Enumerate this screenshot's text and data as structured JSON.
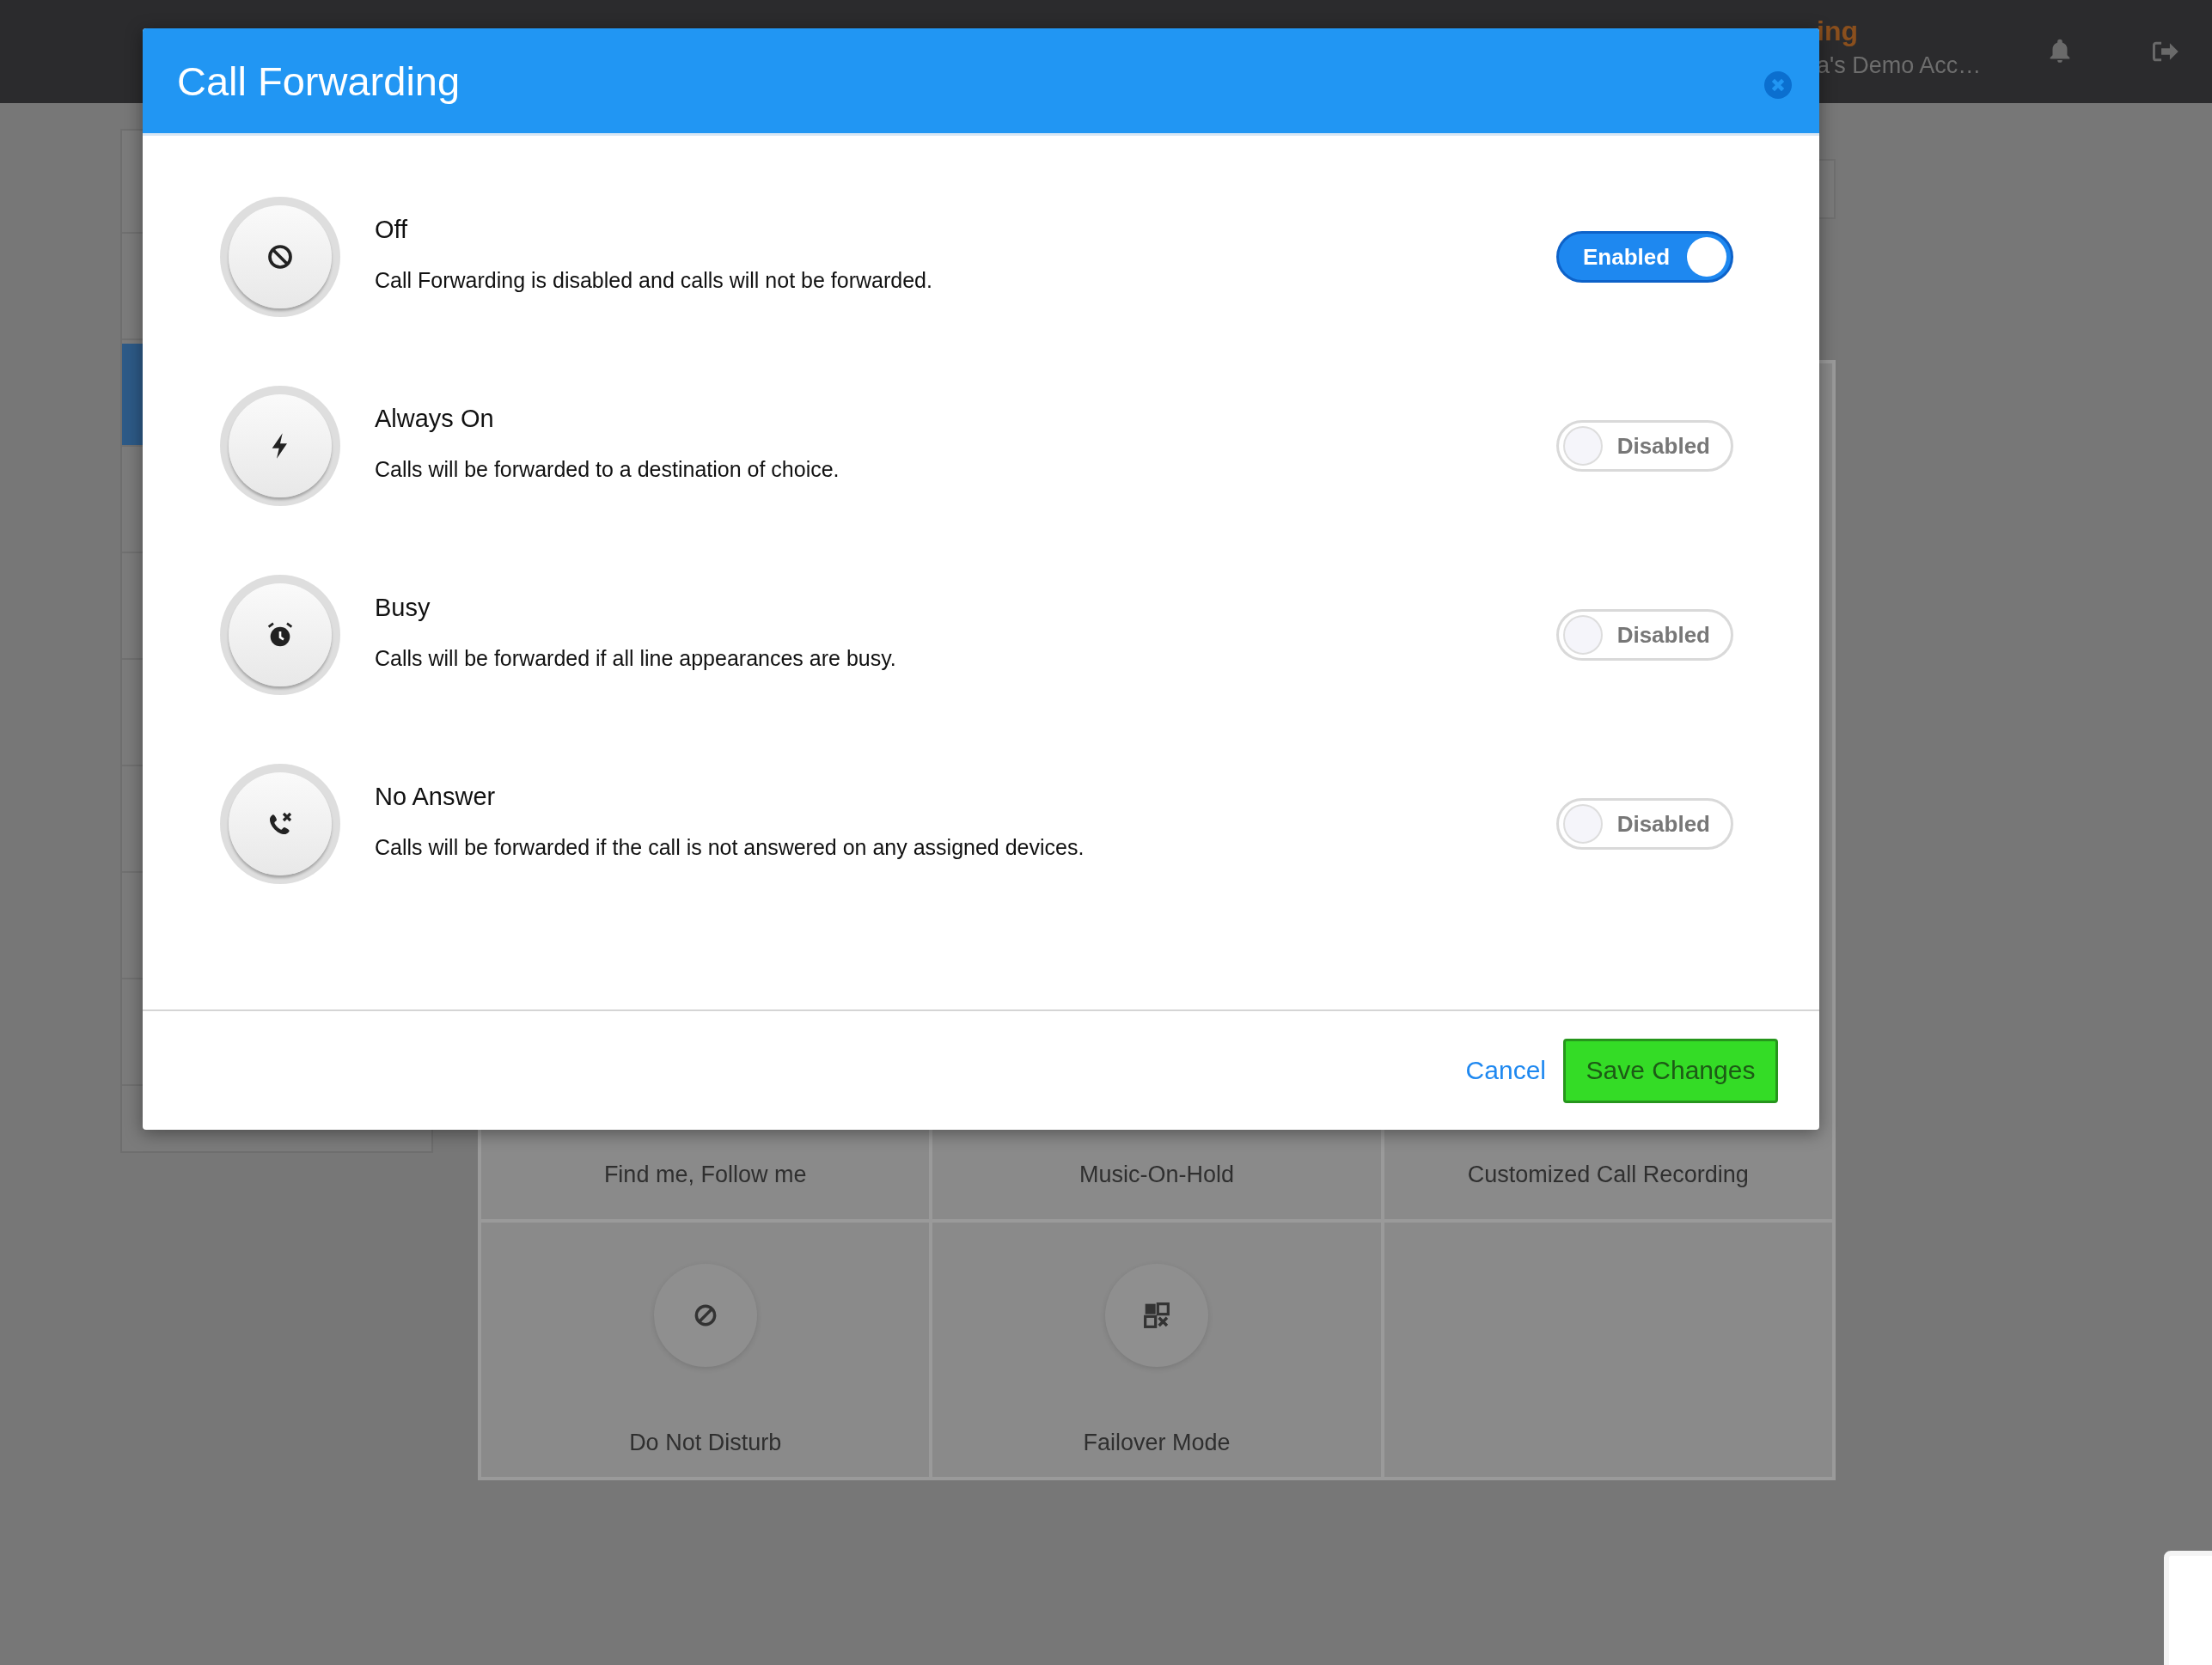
{
  "top_bar": {
    "masquerade_label": "ing",
    "account_name": "a's Demo Acc…"
  },
  "dialog": {
    "title": "Call Forwarding",
    "options": [
      {
        "kind": "ban",
        "title": "Off",
        "description": "Call Forwarding is disabled and calls will not be forwarded.",
        "on": true,
        "toggle_label": "Enabled"
      },
      {
        "kind": "bolt",
        "title": "Always On",
        "description": "Calls will be forwarded to a destination of choice.",
        "on": false,
        "toggle_label": "Disabled"
      },
      {
        "kind": "alarm",
        "title": "Busy",
        "description": "Calls will be forwarded if all line appearances are busy.",
        "on": false,
        "toggle_label": "Disabled"
      },
      {
        "kind": "phone-x",
        "title": "No Answer",
        "description": "Calls will be forwarded if the call is not answered on any assigned devices.",
        "on": false,
        "toggle_label": "Disabled"
      }
    ],
    "cancel": "Cancel",
    "save": "Save Changes"
  },
  "feature_tiles": [
    {
      "kind": "label-only",
      "label": "Find me, Follow me"
    },
    {
      "kind": "label-only",
      "label": "Music-On-Hold"
    },
    {
      "kind": "label-only",
      "label": "Customized Call Recording"
    },
    {
      "kind": "dnd",
      "label": "Do Not Disturb"
    },
    {
      "kind": "failover",
      "label": "Failover Mode"
    }
  ]
}
